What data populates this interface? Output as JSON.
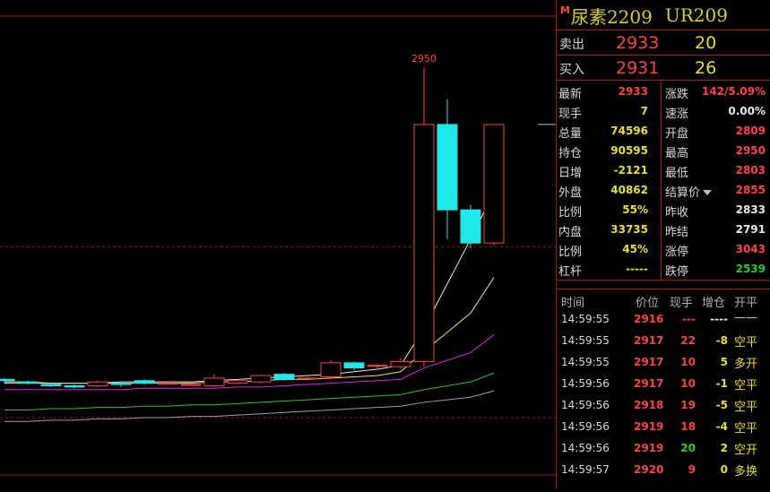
{
  "title": {
    "badge": "M",
    "name": "尿素2209",
    "code": "UR209"
  },
  "quote": {
    "sell": {
      "label": "卖出",
      "price": "2933",
      "volume": "20"
    },
    "buy": {
      "label": "买入",
      "price": "2931",
      "volume": "26"
    }
  },
  "stats": [
    {
      "l1": "最新",
      "v1": "2933",
      "c1": "red",
      "l2": "涨跌",
      "v2": "142/5.09%",
      "c2": "red"
    },
    {
      "l1": "现手",
      "v1": "7",
      "c1": "yellow",
      "l2": "速涨",
      "v2": "0.00%",
      "c2": "white"
    },
    {
      "l1": "总量",
      "v1": "74596",
      "c1": "yellow",
      "l2": "开盘",
      "v2": "2809",
      "c2": "red"
    },
    {
      "l1": "持仓",
      "v1": "90595",
      "c1": "yellow",
      "l2": "最高",
      "v2": "2950",
      "c2": "red"
    },
    {
      "l1": "日增",
      "v1": "-2121",
      "c1": "yellow",
      "l2": "最低",
      "v2": "2803",
      "c2": "red"
    },
    {
      "l1": "外盘",
      "v1": "40862",
      "c1": "yellow",
      "l2": "结算价",
      "v2": "2855",
      "c2": "red",
      "dropdown": true
    },
    {
      "l1": "比例",
      "v1": "55%",
      "c1": "yellow",
      "l2": "昨收",
      "v2": "2833",
      "c2": "white"
    },
    {
      "l1": "内盘",
      "v1": "33735",
      "c1": "yellow",
      "l2": "昨结",
      "v2": "2791",
      "c2": "white"
    },
    {
      "l1": "比例",
      "v1": "45%",
      "c1": "yellow",
      "l2": "涨停",
      "v2": "3043",
      "c2": "red"
    },
    {
      "l1": "杠杆",
      "v1": "-----",
      "c1": "yellow",
      "l2": "跌停",
      "v2": "2539",
      "c2": "green"
    }
  ],
  "ticks": {
    "headers": [
      "时间",
      "价位",
      "现手",
      "增仓",
      "开平"
    ],
    "rows": [
      {
        "time": "14:59:55",
        "price": "2916",
        "vol": "---",
        "vol_c": "red",
        "chg": "----",
        "chg_c": "white",
        "type": "——",
        "type_c": "yellow"
      },
      {
        "time": "14:59:55",
        "price": "2917",
        "vol": "22",
        "vol_c": "red",
        "chg": "-8",
        "chg_c": "yellow",
        "type": "空平",
        "type_c": "yellow"
      },
      {
        "time": "14:59:55",
        "price": "2917",
        "vol": "10",
        "vol_c": "red",
        "chg": "5",
        "chg_c": "yellow",
        "type": "多开",
        "type_c": "yellow"
      },
      {
        "time": "14:59:56",
        "price": "2917",
        "vol": "10",
        "vol_c": "red",
        "chg": "-1",
        "chg_c": "yellow",
        "type": "空平",
        "type_c": "yellow"
      },
      {
        "time": "14:59:56",
        "price": "2918",
        "vol": "19",
        "vol_c": "red",
        "chg": "-5",
        "chg_c": "yellow",
        "type": "空平",
        "type_c": "yellow"
      },
      {
        "time": "14:59:56",
        "price": "2919",
        "vol": "18",
        "vol_c": "red",
        "chg": "-4",
        "chg_c": "yellow",
        "type": "空平",
        "type_c": "yellow"
      },
      {
        "time": "14:59:56",
        "price": "2919",
        "vol": "20",
        "vol_c": "green",
        "chg": "2",
        "chg_c": "yellow",
        "type": "空开",
        "type_c": "yellow"
      },
      {
        "time": "14:59:57",
        "price": "2920",
        "vol": "9",
        "vol_c": "red",
        "chg": "0",
        "chg_c": "yellow",
        "type": "多换",
        "type_c": "yellow"
      }
    ]
  },
  "chart_data": {
    "type": "candlestick",
    "high_label": "2950",
    "candles": [
      {
        "o": 2705,
        "h": 2706,
        "l": 2702,
        "c": 2704
      },
      {
        "o": 2703,
        "h": 2704,
        "l": 2701,
        "c": 2702
      },
      {
        "o": 2701,
        "h": 2702,
        "l": 2699,
        "c": 2700
      },
      {
        "o": 2700,
        "h": 2701,
        "l": 2698,
        "c": 2699
      },
      {
        "o": 2700,
        "h": 2704,
        "l": 2699,
        "c": 2703
      },
      {
        "o": 2702,
        "h": 2703,
        "l": 2699,
        "c": 2701
      },
      {
        "o": 2704,
        "h": 2705,
        "l": 2701,
        "c": 2702
      },
      {
        "o": 2702,
        "h": 2703,
        "l": 2701,
        "c": 2702
      },
      {
        "o": 2701,
        "h": 2702,
        "l": 2700,
        "c": 2701
      },
      {
        "o": 2700,
        "h": 2709,
        "l": 2699,
        "c": 2706
      },
      {
        "o": 2702,
        "h": 2705,
        "l": 2701,
        "c": 2704
      },
      {
        "o": 2703,
        "h": 2709,
        "l": 2702,
        "c": 2708
      },
      {
        "o": 2709,
        "h": 2710,
        "l": 2704,
        "c": 2705
      },
      {
        "o": 2706,
        "h": 2707,
        "l": 2704,
        "c": 2706
      },
      {
        "o": 2707,
        "h": 2720,
        "l": 2705,
        "c": 2718
      },
      {
        "o": 2718,
        "h": 2719,
        "l": 2712,
        "c": 2714
      },
      {
        "o": 2716,
        "h": 2717,
        "l": 2712,
        "c": 2716
      },
      {
        "o": 2715,
        "h": 2722,
        "l": 2714,
        "c": 2719
      },
      {
        "o": 2719,
        "h": 2950,
        "l": 2715,
        "c": 2905
      },
      {
        "o": 2905,
        "h": 2925,
        "l": 2815,
        "c": 2838
      },
      {
        "o": 2838,
        "h": 2842,
        "l": 2808,
        "c": 2812
      },
      {
        "o": 2812,
        "h": 2905,
        "l": 2810,
        "c": 2905
      }
    ],
    "last_price": 2905,
    "ref_price": 2809,
    "ylim": [
      2630,
      2990
    ],
    "ma": [
      {
        "name": "MA5",
        "color": "#e8e8e8",
        "values": [
          2703,
          2703,
          2702,
          2702,
          2702,
          2703,
          2703,
          2703,
          2703,
          2704,
          2705,
          2706,
          2707,
          2708,
          2709,
          2711,
          2713,
          2716,
          2745,
          2780,
          2815,
          2852
        ]
      },
      {
        "name": "MA10",
        "color": "#e8e080",
        "values": [
          2702,
          2702,
          2702,
          2702,
          2702,
          2702,
          2702,
          2702,
          2702,
          2703,
          2703,
          2704,
          2705,
          2705,
          2706,
          2707,
          2708,
          2711,
          2727,
          2742,
          2757,
          2785
        ]
      },
      {
        "name": "MA20",
        "color": "#e020e0",
        "values": [
          2697,
          2697,
          2697,
          2697,
          2697,
          2697,
          2698,
          2698,
          2698,
          2698,
          2699,
          2699,
          2700,
          2701,
          2702,
          2703,
          2704,
          2705,
          2714,
          2720,
          2726,
          2740
        ]
      },
      {
        "name": "MA40",
        "color": "#30c030",
        "values": [
          2681,
          2681,
          2682,
          2682,
          2683,
          2683,
          2684,
          2684,
          2685,
          2685,
          2686,
          2687,
          2688,
          2689,
          2690,
          2691,
          2692,
          2693,
          2697,
          2700,
          2703,
          2710
        ]
      },
      {
        "name": "MA60",
        "color": "#a0a0a0",
        "values": [
          2672,
          2672,
          2673,
          2673,
          2674,
          2674,
          2675,
          2675,
          2676,
          2676,
          2677,
          2678,
          2679,
          2680,
          2681,
          2682,
          2683,
          2684,
          2687,
          2689,
          2691,
          2696
        ]
      }
    ]
  }
}
